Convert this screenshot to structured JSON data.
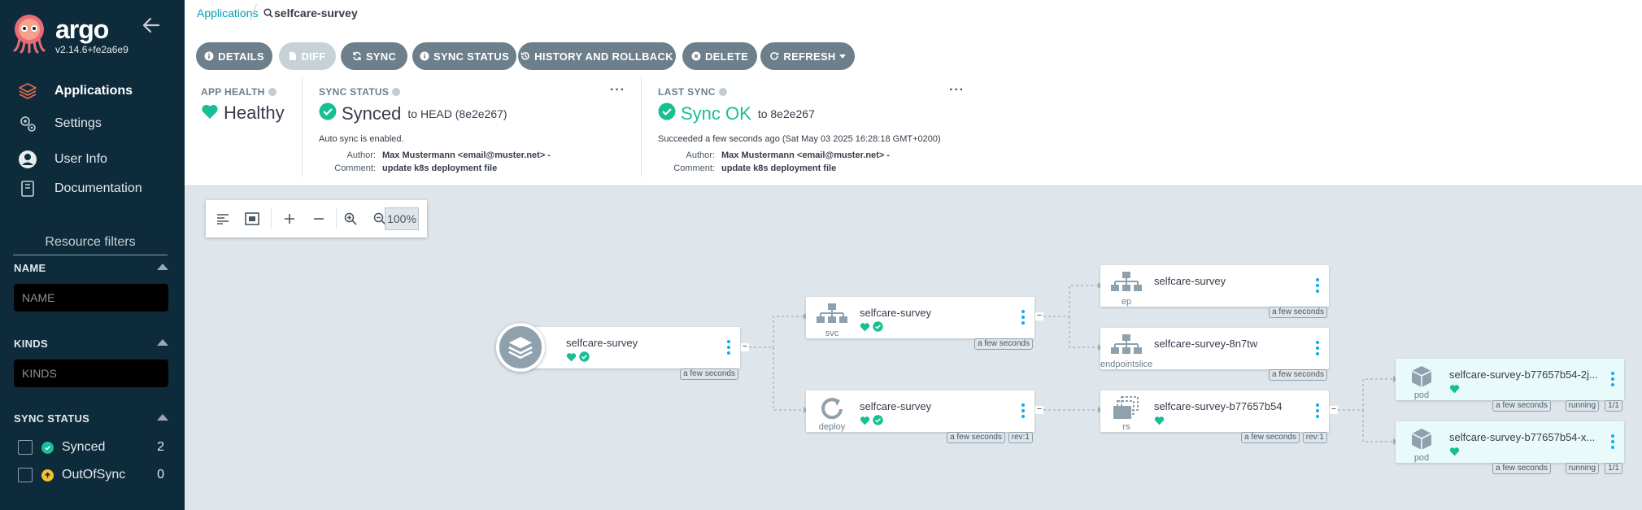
{
  "sidebar": {
    "brand": "argo",
    "version": "v2.14.6+fe2a6e9",
    "nav": [
      {
        "label": "Applications",
        "icon": "layers-icon"
      },
      {
        "label": "Settings",
        "icon": "gears-icon"
      },
      {
        "label": "User Info",
        "icon": "user-circle-icon"
      },
      {
        "label": "Documentation",
        "icon": "book-icon"
      }
    ],
    "resource_filters_title": "Resource filters",
    "filters": {
      "name_label": "NAME",
      "name_placeholder": "NAME",
      "kinds_label": "KINDS",
      "kinds_placeholder": "KINDS",
      "sync_status_label": "SYNC STATUS",
      "sync_status_options": [
        {
          "label": "Synced",
          "count": "2",
          "color": "#18be94"
        },
        {
          "label": "OutOfSync",
          "count": "0",
          "color": "#f4c030"
        }
      ]
    }
  },
  "breadcrumb": {
    "root": "Applications",
    "current": "selfcare-survey"
  },
  "actions": {
    "details": "DETAILS",
    "diff": "DIFF",
    "sync": "SYNC",
    "sync_status": "SYNC STATUS",
    "history": "HISTORY AND ROLLBACK",
    "delete": "DELETE",
    "refresh": "REFRESH"
  },
  "status": {
    "app_health_title": "APP HEALTH",
    "app_health_value": "Healthy",
    "sync_status_title": "SYNC STATUS",
    "sync_status_value": "Synced",
    "sync_status_target": "to HEAD (8e2e267)",
    "auto_sync": "Auto sync is enabled.",
    "author_key": "Author:",
    "comment_key": "Comment:",
    "author": "Max Mustermann <email@muster.net> -",
    "comment": "update k8s deployment file",
    "last_sync_title": "LAST SYNC",
    "last_sync_value": "Sync OK",
    "last_sync_target": "to 8e2e267",
    "last_sync_detail": "Succeeded a few seconds ago (Sat May 03 2025 16:28:18 GMT+0200)",
    "last_author": "Max Mustermann <email@muster.net> -",
    "last_comment": "update k8s deployment file",
    "more": "···"
  },
  "zoom": {
    "level": "100%"
  },
  "tree": {
    "app": {
      "name": "selfcare-survey",
      "age": "a few seconds"
    },
    "svc": {
      "name": "selfcare-survey",
      "kind": "svc",
      "age": "a few seconds"
    },
    "deploy": {
      "name": "selfcare-survey",
      "kind": "deploy",
      "age": "a few seconds",
      "rev": "rev:1"
    },
    "ep": {
      "name": "selfcare-survey",
      "kind": "ep",
      "age": "a few seconds"
    },
    "endpointslice": {
      "name": "selfcare-survey-8n7tw",
      "kind": "endpointslice",
      "age": "a few seconds"
    },
    "rs": {
      "name": "selfcare-survey-b77657b54",
      "kind": "rs",
      "age": "a few seconds",
      "rev": "rev:1"
    },
    "pod1": {
      "name": "selfcare-survey-b77657b54-2j...",
      "kind": "pod",
      "age": "a few seconds",
      "state": "running",
      "ready": "1/1"
    },
    "pod2": {
      "name": "selfcare-survey-b77657b54-x...",
      "kind": "pod",
      "age": "a few seconds",
      "state": "running",
      "ready": "1/1"
    }
  },
  "colors": {
    "sidebar_bg": "#0e2b3c",
    "healthy": "#18be94",
    "accent": "#00a2b3",
    "button": "#6d7f8b",
    "canvas": "#dee6eb"
  }
}
